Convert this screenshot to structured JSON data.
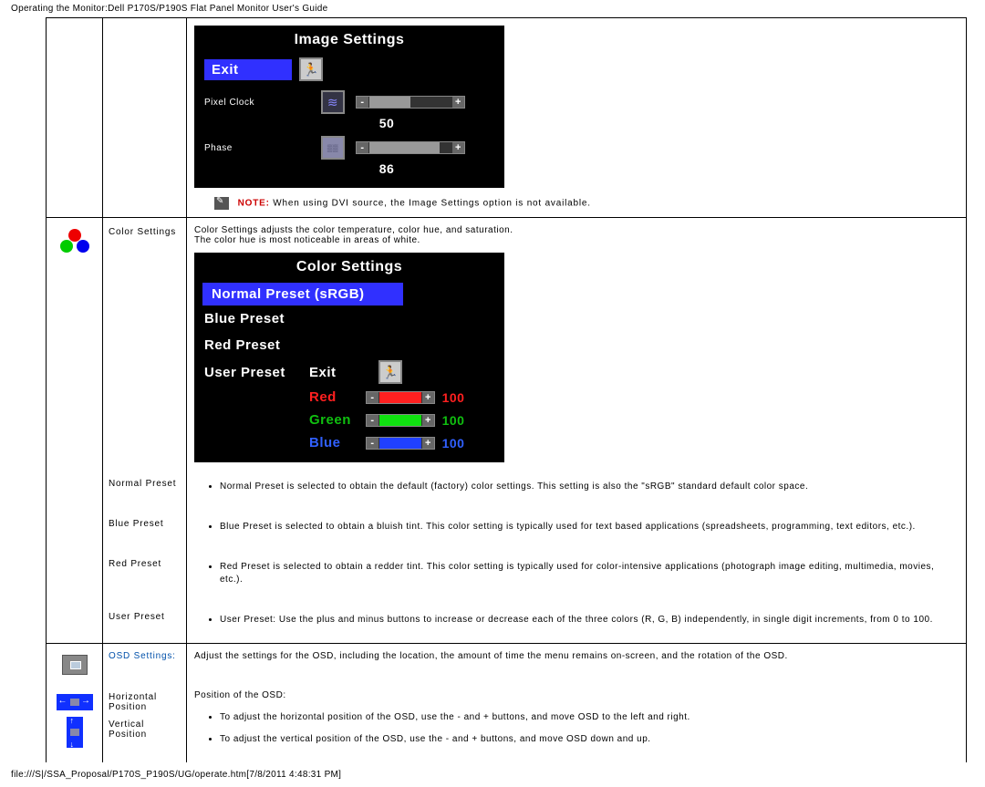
{
  "header": "Operating the Monitor:Dell P170S/P190S Flat Panel Monitor User's Guide",
  "footer": "file:///S|/SSA_Proposal/P170S_P190S/UG/operate.htm[7/8/2011 4:48:31 PM]",
  "img_settings": {
    "title": "Image Settings",
    "exit": "Exit",
    "pixel_clock_label": "Pixel Clock",
    "pixel_clock_value": "50",
    "phase_label": "Phase",
    "phase_value": "86"
  },
  "note": {
    "prefix": "NOTE:",
    "text": "When using  DVI source, the Image Settings option is not available."
  },
  "color_row": {
    "label": "Color Settings",
    "desc1": "Color Settings adjusts the color temperature, color hue, and saturation.",
    "desc2": "The color hue is most noticeable in areas of white."
  },
  "color_panel": {
    "title": "Color Settings",
    "normal": "Normal Preset (sRGB)",
    "blue": "Blue Preset",
    "red_p": "Red Preset",
    "user": "User Preset",
    "exit": "Exit",
    "red": "Red",
    "green": "Green",
    "blue_l": "Blue",
    "v_red": "100",
    "v_green": "100",
    "v_blue": "100"
  },
  "presets": {
    "normal_label": "Normal Preset",
    "normal_text": "Normal Preset is selected to obtain the default (factory) color settings. This setting is also the \"sRGB\" standard default color space.",
    "blue_label": "Blue Preset",
    "blue_text": "Blue Preset is selected to obtain a bluish tint. This color setting is typically used for text based applications (spreadsheets, programming, text editors, etc.).",
    "red_label": "Red Preset",
    "red_text": "Red Preset is selected to obtain a redder tint. This color setting is typically used for color-intensive applications (photograph image editing, multimedia, movies, etc.).",
    "user_label": "User Preset",
    "user_text": "User Preset: Use the plus and minus buttons to increase or decrease each of the three colors (R, G, B) independently, in single digit increments, from 0 to 100."
  },
  "osd": {
    "label": "OSD Settings:",
    "desc": "Adjust the settings for the OSD, including the location, the amount of time the menu remains on-screen, and the rotation of the OSD.",
    "hpos": "Horizontal Position",
    "vpos": "Vertical Position",
    "pos_label": "Position of the OSD:",
    "bullet1": "To adjust the horizontal position of the OSD, use the - and + buttons, and move OSD to the left and right.",
    "bullet2": "To adjust the vertical position of the OSD, use the - and + buttons, and move OSD down and up."
  }
}
